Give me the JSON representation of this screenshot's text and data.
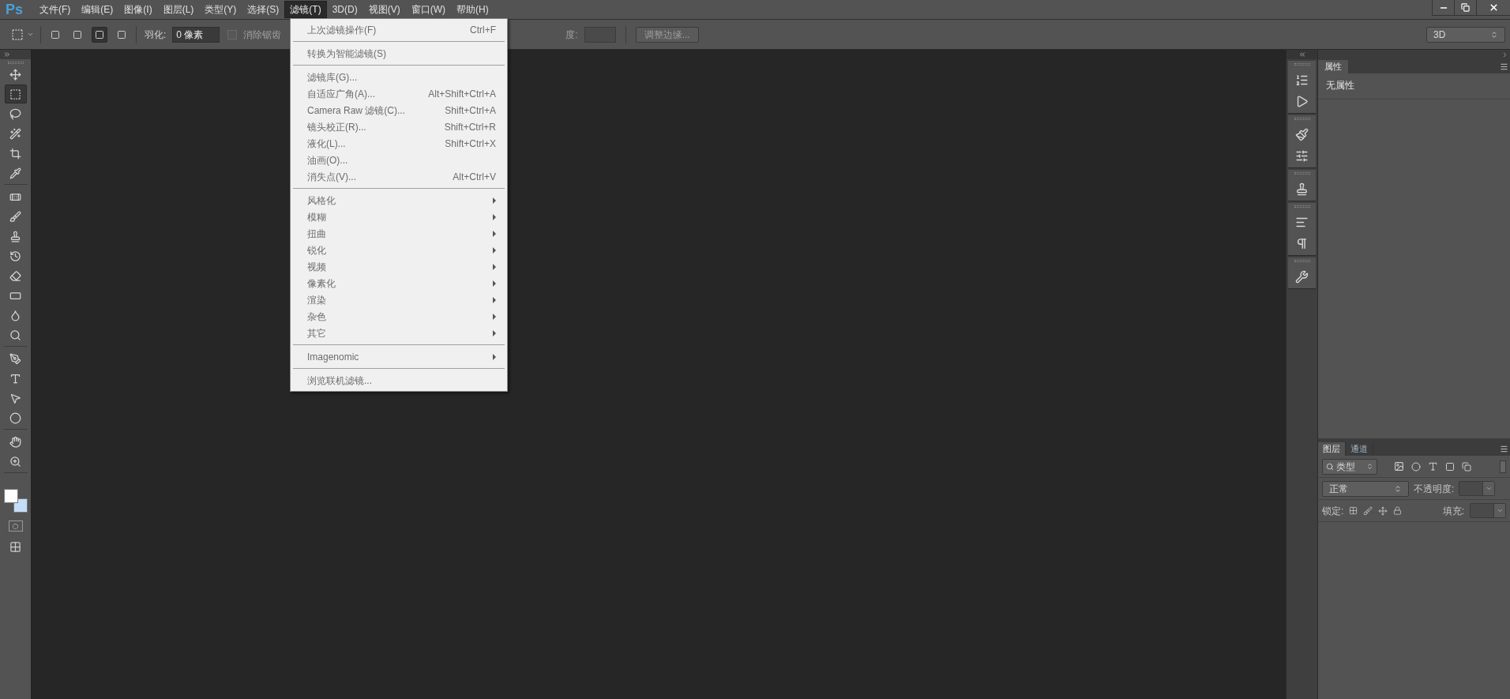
{
  "app_logo": "Ps",
  "menu_bar": [
    {
      "label": "文件(F)",
      "selected": false
    },
    {
      "label": "编辑(E)",
      "selected": false
    },
    {
      "label": "图像(I)",
      "selected": false
    },
    {
      "label": "图层(L)",
      "selected": false
    },
    {
      "label": "类型(Y)",
      "selected": false
    },
    {
      "label": "选择(S)",
      "selected": false
    },
    {
      "label": "滤镜(T)",
      "selected": true
    },
    {
      "label": "3D(D)",
      "selected": false
    },
    {
      "label": "视图(V)",
      "selected": false
    },
    {
      "label": "窗口(W)",
      "selected": false
    },
    {
      "label": "帮助(H)",
      "selected": false
    }
  ],
  "options_bar": {
    "selection_modes": [
      {
        "selected": false
      },
      {
        "selected": false
      },
      {
        "selected": true
      },
      {
        "selected": false
      }
    ],
    "feather_label": "羽化:",
    "feather_value": "0 像素",
    "antialias": {
      "label": "消除锯齿",
      "checked": false,
      "disabled": true
    },
    "partial_label": "度:",
    "refine_edge_button": "调整边缘..."
  },
  "workspace": "3D",
  "tools": [
    {
      "selected": false
    },
    {
      "selected": true
    },
    {
      "selected": false
    },
    {
      "selected": false
    },
    {
      "selected": false
    },
    {
      "selected": false
    },
    {
      "selected": false
    },
    {
      "selected": false
    },
    {
      "selected": false
    },
    {
      "selected": false
    },
    {
      "selected": false
    },
    {
      "selected": false
    },
    {
      "selected": false
    },
    {
      "selected": false
    },
    {
      "selected": false
    },
    {
      "selected": false
    },
    {
      "selected": false
    },
    {
      "selected": false
    },
    {
      "selected": false
    },
    {
      "selected": false
    }
  ],
  "filter_menu": [
    [
      {
        "label": "上次滤镜操作(F)",
        "shortcut": "Ctrl+F",
        "kind": "item",
        "disabled": true
      }
    ],
    [
      {
        "label": "转换为智能滤镜(S)",
        "kind": "item",
        "disabled": true
      }
    ],
    [
      {
        "label": "滤镜库(G)...",
        "kind": "item",
        "disabled": true
      },
      {
        "label": "自适应广角(A)...",
        "shortcut": "Alt+Shift+Ctrl+A",
        "kind": "item",
        "disabled": true
      },
      {
        "label": "Camera Raw 滤镜(C)...",
        "shortcut": "Shift+Ctrl+A",
        "kind": "item",
        "disabled": true
      },
      {
        "label": "镜头校正(R)...",
        "shortcut": "Shift+Ctrl+R",
        "kind": "item",
        "disabled": true
      },
      {
        "label": "液化(L)...",
        "shortcut": "Shift+Ctrl+X",
        "kind": "item",
        "disabled": true
      },
      {
        "label": "油画(O)...",
        "kind": "item",
        "disabled": true
      },
      {
        "label": "消失点(V)...",
        "shortcut": "Alt+Ctrl+V",
        "kind": "item",
        "disabled": true
      }
    ],
    [
      {
        "label": "风格化",
        "kind": "submenu",
        "disabled": true
      },
      {
        "label": "模糊",
        "kind": "submenu",
        "disabled": true
      },
      {
        "label": "扭曲",
        "kind": "submenu",
        "disabled": true
      },
      {
        "label": "锐化",
        "kind": "submenu",
        "disabled": true
      },
      {
        "label": "视频",
        "kind": "submenu",
        "disabled": true
      },
      {
        "label": "像素化",
        "kind": "submenu",
        "disabled": true
      },
      {
        "label": "渲染",
        "kind": "submenu",
        "disabled": true
      },
      {
        "label": "杂色",
        "kind": "submenu",
        "disabled": true
      },
      {
        "label": "其它",
        "kind": "submenu",
        "disabled": true
      }
    ],
    [
      {
        "label": "Imagenomic",
        "kind": "submenu",
        "disabled": true
      }
    ],
    [
      {
        "label": "浏览联机滤镜...",
        "kind": "item",
        "disabled": true
      }
    ]
  ],
  "properties_panel": {
    "tabs": [
      {
        "label": "属性",
        "selected": true
      }
    ],
    "content": "无属性"
  },
  "layers_panel": {
    "tabs": [
      {
        "label": "图层",
        "selected": true
      },
      {
        "label": "通道",
        "selected": false
      }
    ],
    "filter_kind": "类型",
    "blend_mode": "正常",
    "opacity_label": "不透明度:",
    "lock_label": "锁定:",
    "fill_label": "填充:"
  }
}
